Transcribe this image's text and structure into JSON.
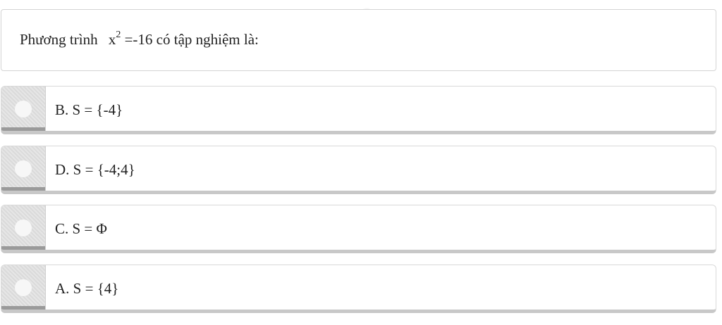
{
  "question": {
    "prefix": "Phương trình",
    "base": "x",
    "exponent": "2",
    "suffix": "=-16 có tập nghiệm là:"
  },
  "options": [
    {
      "label": "B. S = {-4}"
    },
    {
      "label": "D. S = {-4;4}"
    },
    {
      "label": "C. S = Φ"
    },
    {
      "label": "A. S = {4}"
    }
  ],
  "colors": {
    "border": "#d4d4d4",
    "option_bottom_border": "#c8c8c8",
    "radio_area": "#e0e0e0",
    "radio_dot": "#f7f7f7"
  }
}
